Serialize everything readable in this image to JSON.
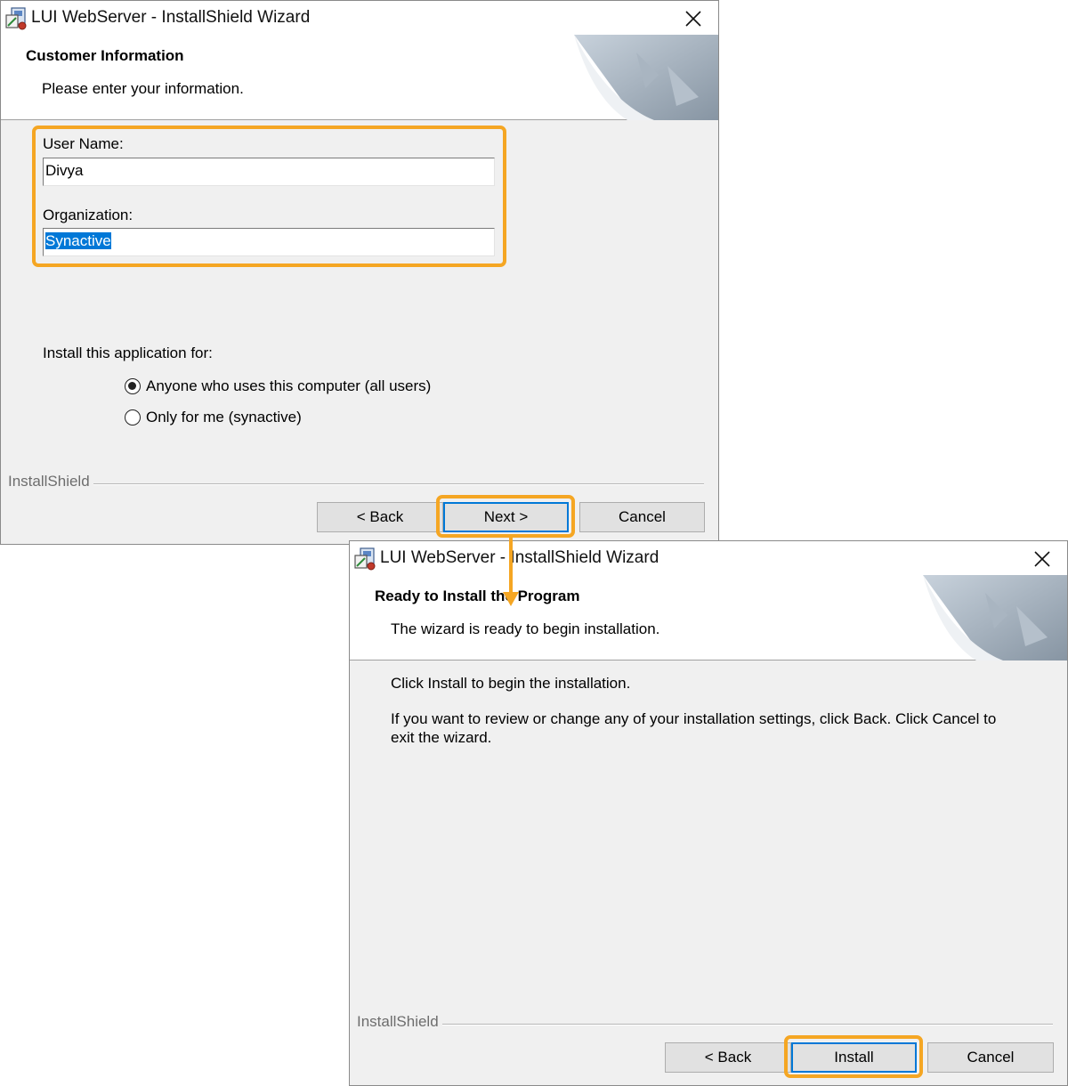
{
  "window1": {
    "title": "LUI WebServer - InstallShield Wizard",
    "header_title": "Customer Information",
    "header_subtitle": "Please enter your information.",
    "user_name_label": "User Name:",
    "user_name_value": "Divya",
    "organization_label": "Organization:",
    "organization_value": "Synactive",
    "install_for_label": "Install this application for:",
    "radio_options": [
      {
        "label": "Anyone who uses this computer (all users)",
        "checked": true
      },
      {
        "label": "Only for me (synactive)",
        "checked": false
      }
    ],
    "brand": "InstallShield",
    "buttons": {
      "back": "< Back",
      "next": "Next >",
      "cancel": "Cancel"
    }
  },
  "window2": {
    "title": "LUI WebServer - InstallShield Wizard",
    "header_title": "Ready to Install the Program",
    "header_subtitle": "The wizard is ready to begin installation.",
    "body_line1": "Click Install to begin the installation.",
    "body_line2": "If you want to review or change any of your installation settings, click Back. Click Cancel to exit the wizard.",
    "brand": "InstallShield",
    "buttons": {
      "back": "< Back",
      "install": "Install",
      "cancel": "Cancel"
    }
  },
  "annotation": {
    "highlight_color": "#f5a623"
  },
  "icons": [
    "installer-icon",
    "close-icon",
    "arrow-down-icon"
  ]
}
